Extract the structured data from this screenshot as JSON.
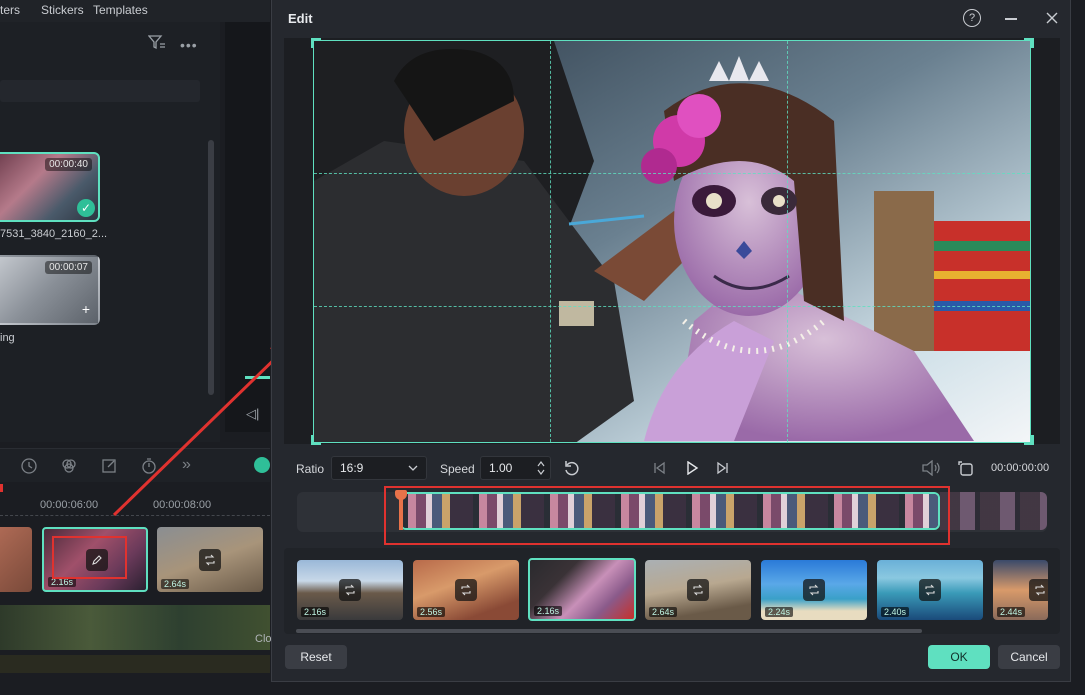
{
  "background_app": {
    "tabs": [
      "ters",
      "Stickers",
      "Templates"
    ],
    "media": [
      {
        "duration": "00:00:40",
        "filename": "7531_3840_2160_2..."
      },
      {
        "duration": "00:00:07",
        "filename": "ing"
      }
    ],
    "timeline": {
      "ruler": [
        "00:00:06:00",
        "00:00:08:00"
      ],
      "clips": [
        "2.16s",
        "2.64s"
      ],
      "track2_label": "Clo"
    }
  },
  "dialog": {
    "title": "Edit",
    "controls": {
      "ratio_label": "Ratio",
      "ratio_value": "16:9",
      "speed_label": "Speed",
      "speed_value": "1.00",
      "timecode": "00:00:00:00"
    },
    "thumbnails": [
      {
        "duration": "2.16s",
        "selected": false,
        "scene": "road"
      },
      {
        "duration": "2.56s",
        "selected": false,
        "scene": "canyon"
      },
      {
        "duration": "2.16s",
        "selected": true,
        "scene": "portrait"
      },
      {
        "duration": "2.64s",
        "selected": false,
        "scene": "desert"
      },
      {
        "duration": "2.24s",
        "selected": false,
        "scene": "beach"
      },
      {
        "duration": "2.40s",
        "selected": false,
        "scene": "coast"
      },
      {
        "duration": "2.44s",
        "selected": false,
        "scene": "sunset"
      }
    ],
    "buttons": {
      "reset": "Reset",
      "ok": "OK",
      "cancel": "Cancel"
    }
  },
  "colors": {
    "accent": "#5fe0c0",
    "highlight": "#e0322f",
    "dialog_bg": "#25282e"
  }
}
